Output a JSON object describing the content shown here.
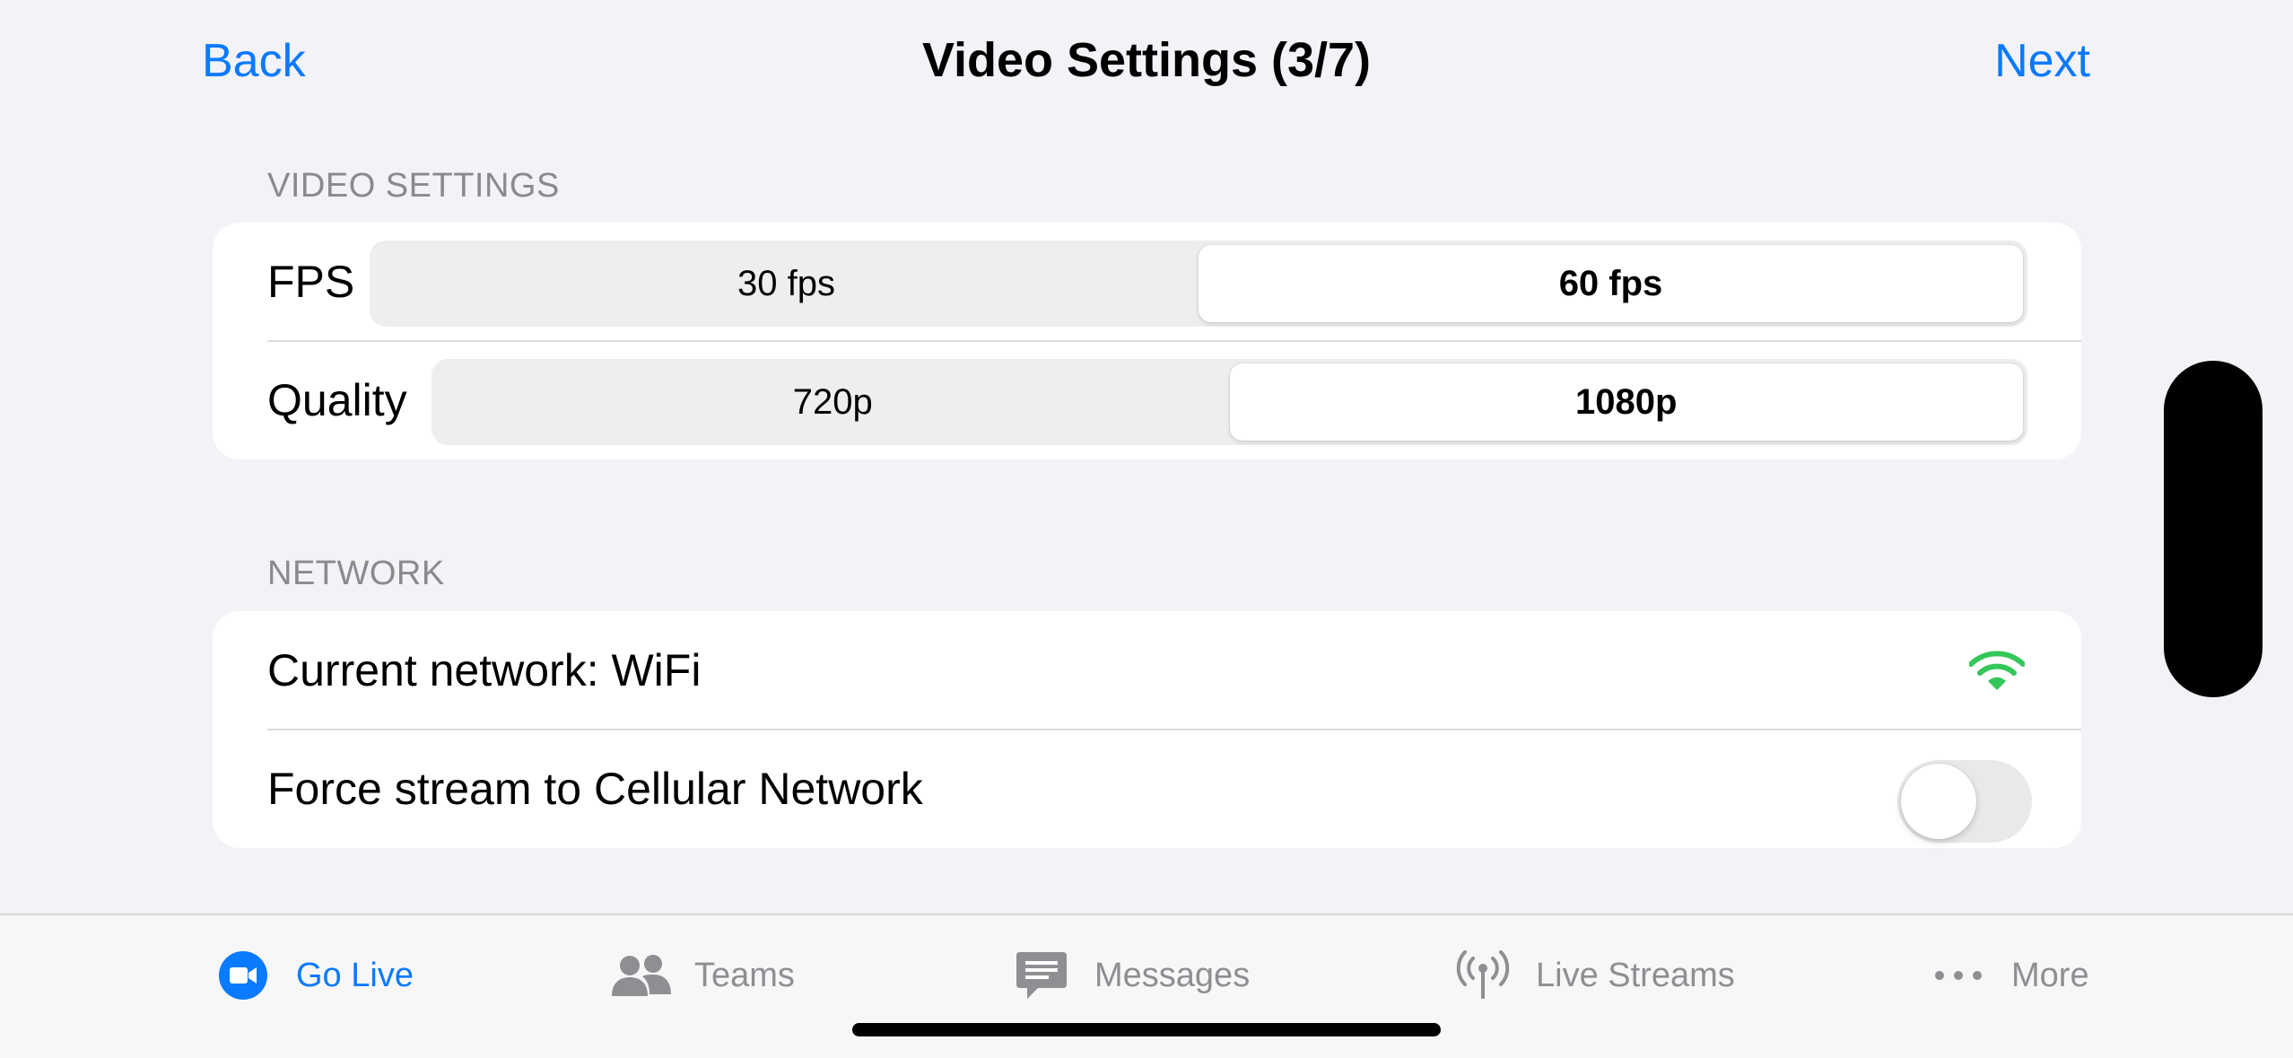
{
  "nav": {
    "back_label": "Back",
    "title": "Video Settings (3/7)",
    "next_label": "Next"
  },
  "video_section": {
    "header": "VIDEO SETTINGS",
    "fps": {
      "label": "FPS",
      "options": [
        "30 fps",
        "60 fps"
      ],
      "selected": "60 fps"
    },
    "quality": {
      "label": "Quality",
      "options": [
        "720p",
        "1080p"
      ],
      "selected": "1080p"
    }
  },
  "network_section": {
    "header": "NETWORK",
    "current_network_label": "Current network: WiFi",
    "network_icon": "wifi-icon",
    "force_cellular_label": "Force stream to Cellular Network",
    "force_cellular_on": false
  },
  "tab_bar": {
    "tabs": [
      {
        "label": "Go Live",
        "icon": "video-camera-icon",
        "active": true
      },
      {
        "label": "Teams",
        "icon": "people-icon",
        "active": false
      },
      {
        "label": "Messages",
        "icon": "chat-bubble-icon",
        "active": false
      },
      {
        "label": "Live Streams",
        "icon": "antenna-icon",
        "active": false
      },
      {
        "label": "More",
        "icon": "ellipsis-icon",
        "active": false
      }
    ]
  },
  "colors": {
    "accent": "#0a7aff",
    "wifi": "#34c759",
    "background": "#f2f2f7",
    "secondary_text": "#8a8a8e"
  }
}
